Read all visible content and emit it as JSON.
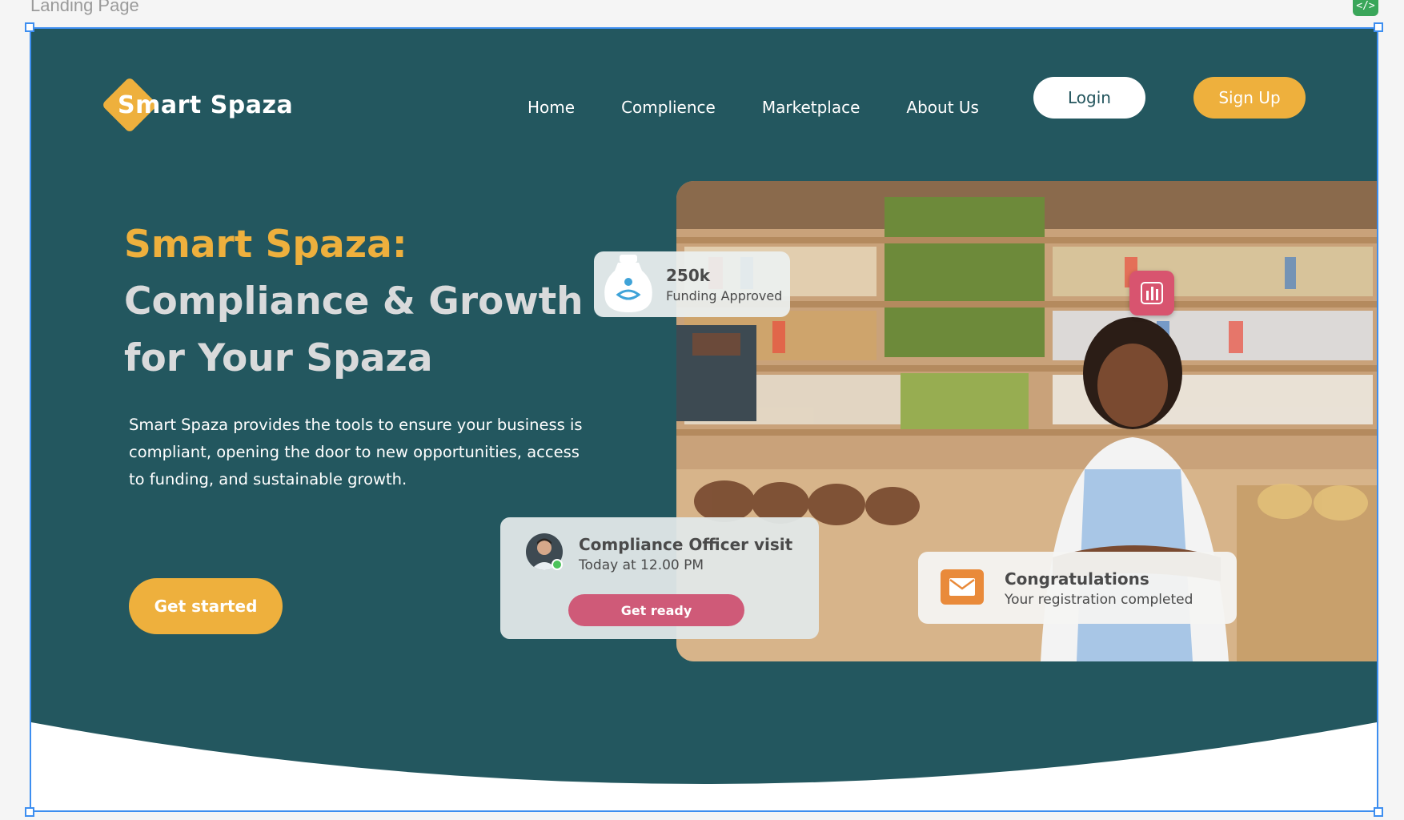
{
  "canvas": {
    "frame_label": "Landing Page",
    "code_badge": "</>"
  },
  "nav": {
    "logo": "Smart Spaza",
    "links": [
      "Home",
      "Complience",
      "Marketplace",
      "About Us"
    ],
    "login": "Login",
    "signup": "Sign Up"
  },
  "hero": {
    "title_accent": "Smart Spaza:",
    "title_line2": "Compliance & Growth",
    "title_line3": "for Your Spaza",
    "description": "Smart Spaza provides the tools to ensure your business is compliant, opening the door to new opportunities, access to funding, and sustainable growth.",
    "cta": "Get started"
  },
  "cards": {
    "funding": {
      "amount": "250k",
      "label": "Funding Approved"
    },
    "visit": {
      "title": "Compliance Officer visit",
      "time": "Today at 12.00 PM",
      "button": "Get ready"
    },
    "congrats": {
      "title": "Congratulations",
      "subtitle": "Your registration completed"
    }
  },
  "colors": {
    "hero_bg": "#23575f",
    "accent": "#eeb03d",
    "pink": "#cf5a78",
    "frame_selection": "#3d8ef0"
  }
}
